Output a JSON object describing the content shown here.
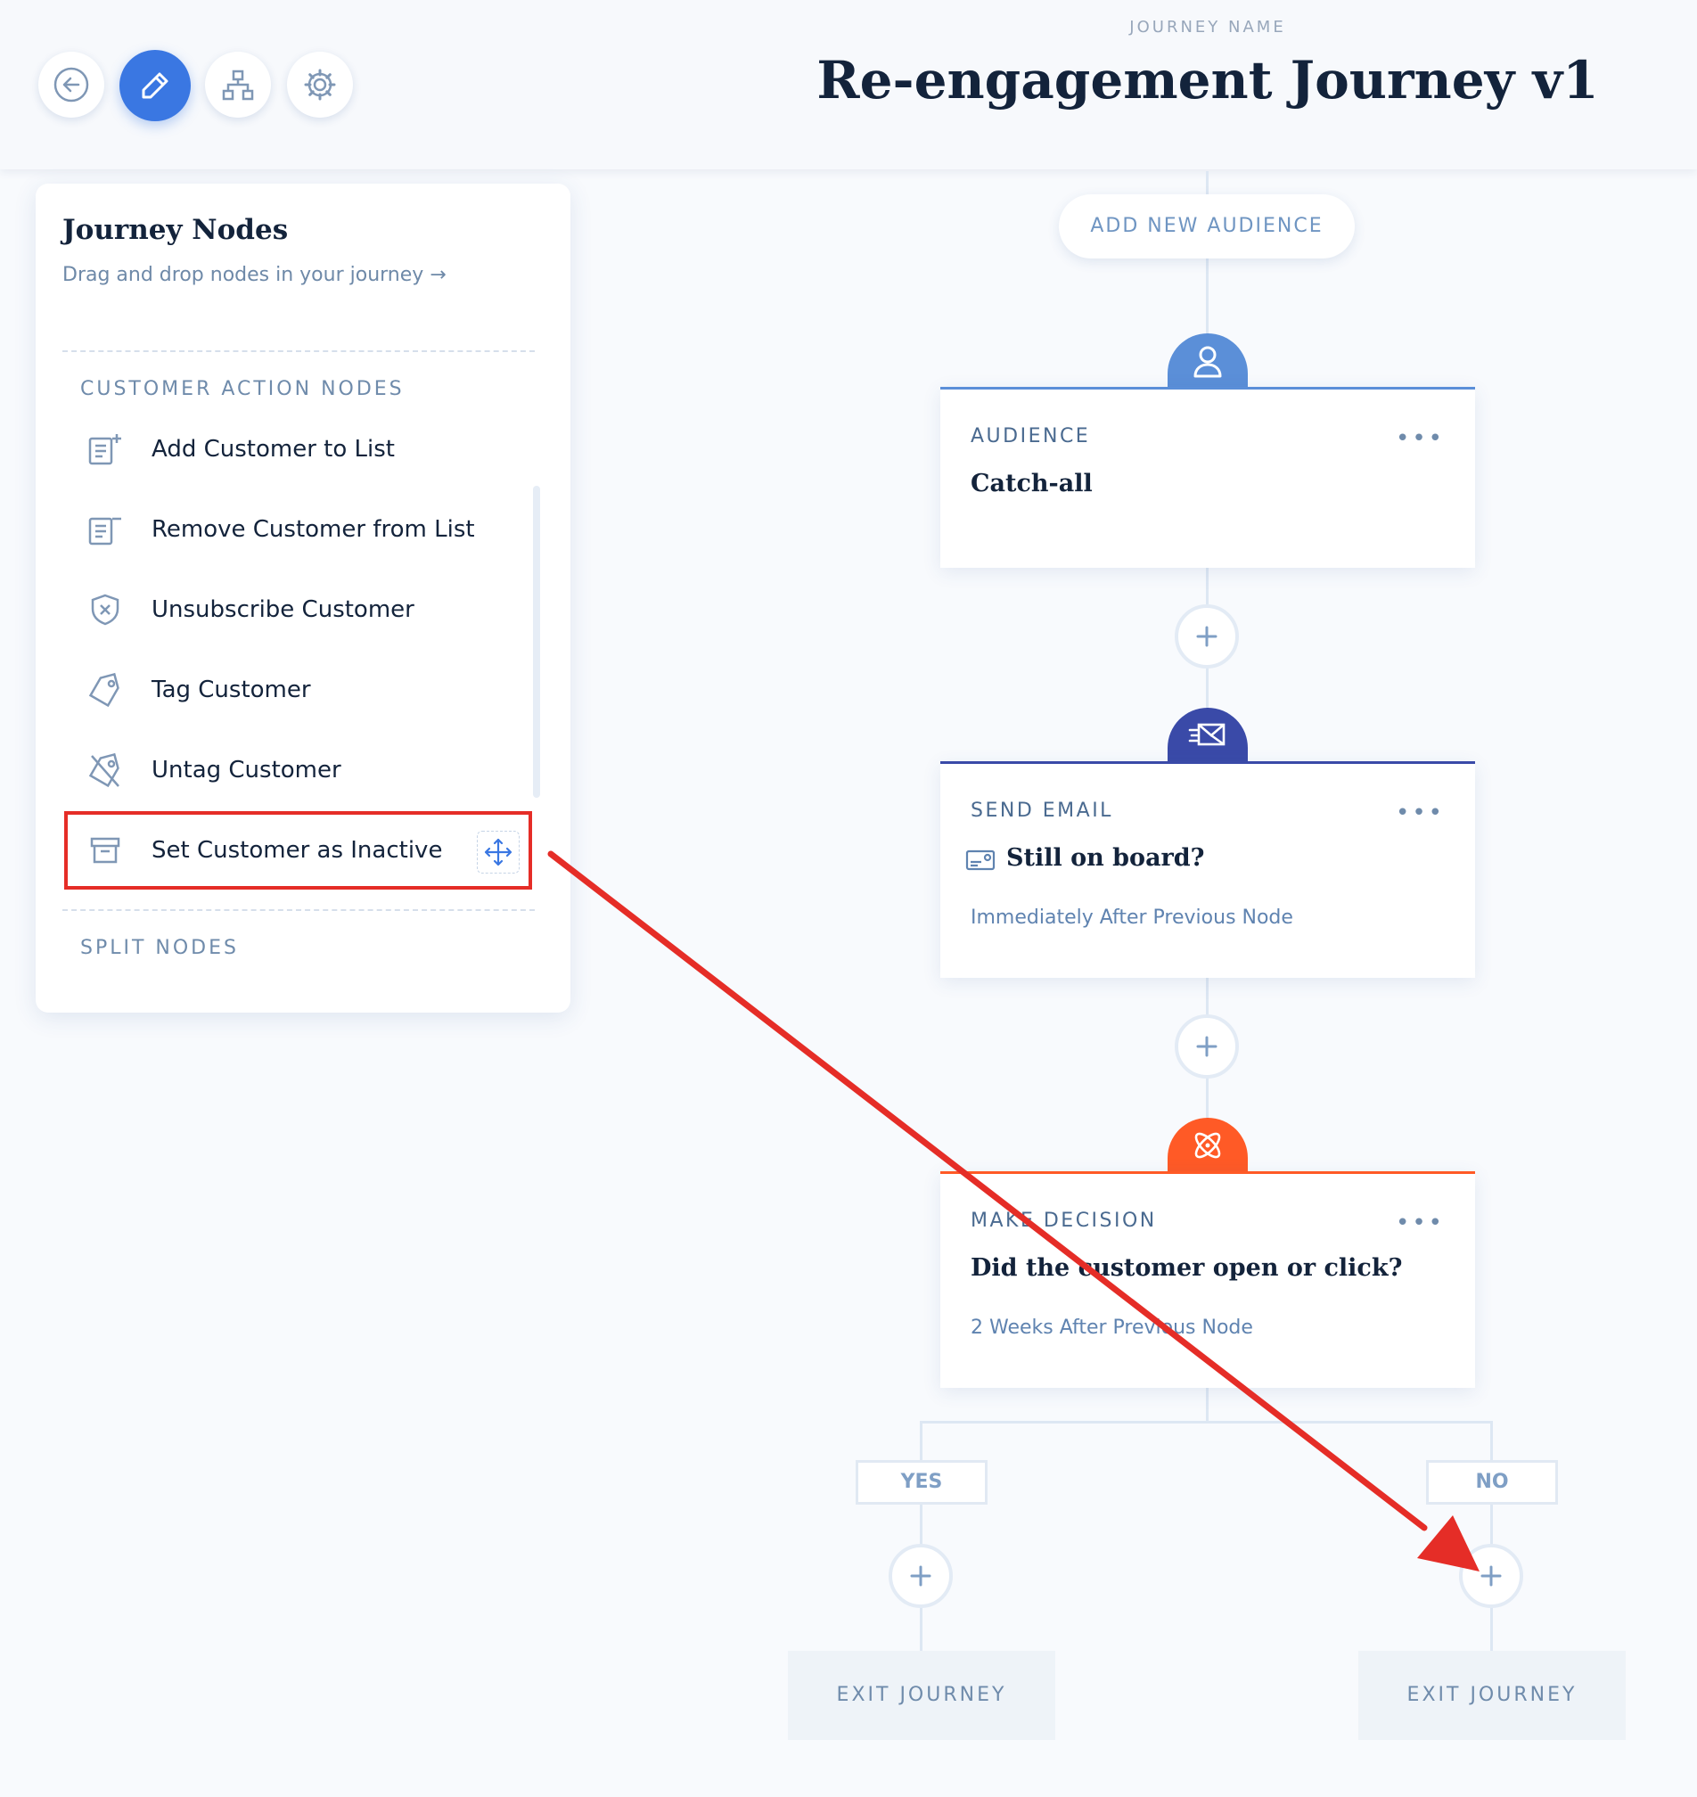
{
  "header": {
    "journey_name_label": "JOURNEY NAME",
    "journey_title": "Re-engagement Journey v1",
    "buttons": [
      "back-icon",
      "pencil-icon",
      "sitemap-icon",
      "gear-icon"
    ],
    "accent": "#3a77e2"
  },
  "sidebar": {
    "title": "Journey Nodes",
    "subtitle": "Drag and drop nodes in your journey →",
    "sections": {
      "customer_action": "CUSTOMER ACTION NODES",
      "split": "SPLIT NODES"
    },
    "items": [
      {
        "label": "Add Customer to List",
        "icon": "list-add-icon"
      },
      {
        "label": "Remove Customer from List",
        "icon": "list-remove-icon"
      },
      {
        "label": "Unsubscribe Customer",
        "icon": "shield-x-icon"
      },
      {
        "label": "Tag Customer",
        "icon": "tag-icon"
      },
      {
        "label": "Untag Customer",
        "icon": "untag-icon"
      },
      {
        "label": "Set Customer as Inactive",
        "icon": "archive-icon",
        "highlighted": true
      }
    ]
  },
  "canvas": {
    "add_audience": "ADD NEW AUDIENCE",
    "nodes": [
      {
        "type": "AUDIENCE",
        "title": "Catch-all",
        "timing": "",
        "color": "#5b8fd8",
        "icon": "user-icon"
      },
      {
        "type": "SEND EMAIL",
        "title": "Still on board?",
        "timing": "Immediately After Previous Node",
        "color": "#3a4aa8",
        "icon": "email-send-icon"
      },
      {
        "type": "MAKE DECISION",
        "title": "Did the customer open or click?",
        "timing": "2 Weeks After Previous Node",
        "color": "#ff5a26",
        "icon": "atom-icon"
      }
    ],
    "more_label": "•••",
    "branches": {
      "yes": "YES",
      "no": "NO",
      "exit_yes": "EXIT JOURNEY",
      "exit_no": "EXIT JOURNEY"
    }
  },
  "annotation": {
    "color": "#e52d27"
  }
}
